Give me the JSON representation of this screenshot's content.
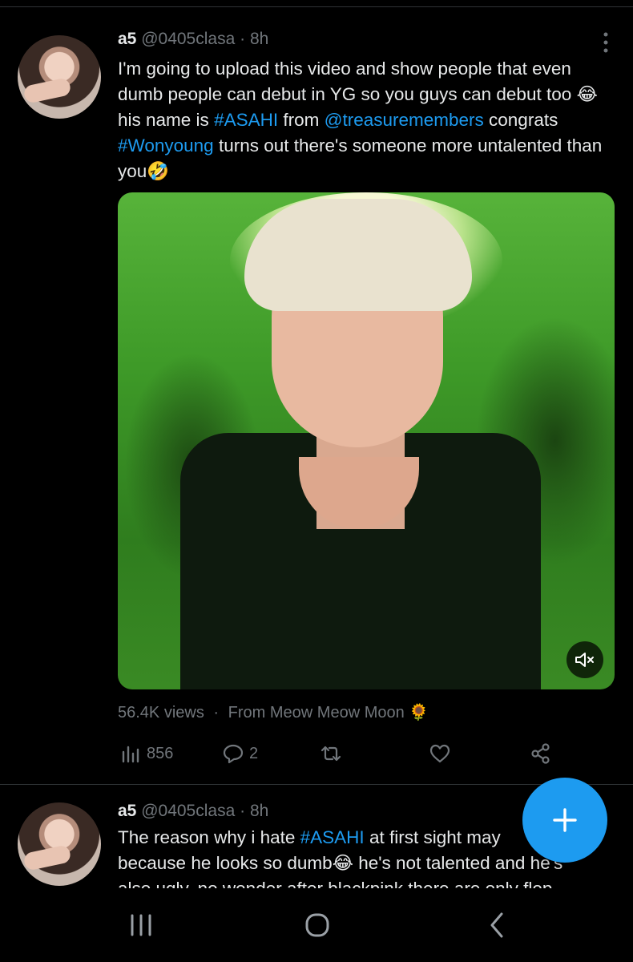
{
  "tweet1": {
    "name": "a5",
    "handle": "@0405clasa",
    "separator": "·",
    "time": "8h",
    "more_icon": "ellipsis-vertical-icon",
    "text_parts": {
      "p1": "I'm going to upload this video and show people that even dumb people can debut in YG so you guys can debut too ",
      "emoji1": "😂",
      "p2": " his name is ",
      "hashtag1": "#ASAHI",
      "p3": " from ",
      "mention1": "@treasuremembers",
      "p4": " congrats ",
      "hashtag2": "#Wonyoung",
      "p5": " turns out there's someone more untalented than you",
      "emoji2": "🤣"
    },
    "media": {
      "mute_icon": "volume-muted-icon"
    },
    "views": "56.4K views",
    "views_sep": "·",
    "source_label": "From",
    "source_name": "Meow Meow Moon",
    "source_emoji": "🌻",
    "actions": {
      "analytics_count": "856",
      "reply_count": "2",
      "retweet_count": "",
      "like_count": ""
    }
  },
  "tweet2": {
    "name": "a5",
    "handle": "@0405clasa",
    "separator": "·",
    "time": "8h",
    "text_parts": {
      "p1": "The reason why i hate ",
      "hashtag1": "#ASAHI",
      "p2": " at first sight may",
      "p3": "because he looks so dumb",
      "emoji1": "😂",
      "p4": " he's not talented and he's",
      "p5": "also ugly, no wonder after blackpink there are only flop"
    }
  },
  "fab": {
    "icon": "plus-icon"
  },
  "navbar": {
    "recent_icon": "recent-apps-icon",
    "home_icon": "home-icon",
    "back_icon": "back-icon"
  },
  "colors": {
    "accent": "#1d9bf0",
    "background": "#000000",
    "muted": "#71767b",
    "text": "#e7e9ea"
  }
}
